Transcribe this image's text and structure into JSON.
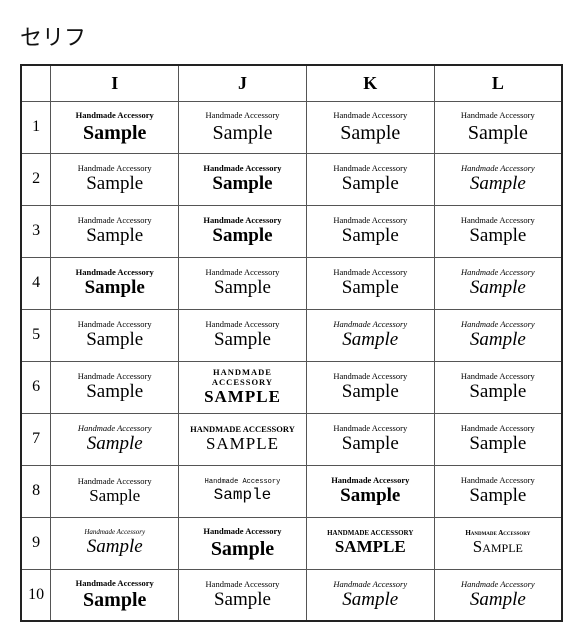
{
  "title": "セリフ",
  "columns": [
    "",
    "I",
    "J",
    "K",
    "L"
  ],
  "topText": "Handmade Accessory",
  "bottomText": "Sample",
  "bottomTextUpper": "SAMPLE",
  "rows": [
    {
      "num": "1",
      "cells": [
        "I",
        "J",
        "K",
        "L"
      ]
    },
    {
      "num": "2",
      "cells": [
        "I",
        "J",
        "K",
        "L"
      ]
    },
    {
      "num": "3",
      "cells": [
        "I",
        "J",
        "K",
        "L"
      ]
    },
    {
      "num": "4",
      "cells": [
        "I",
        "J",
        "K",
        "L"
      ]
    },
    {
      "num": "5",
      "cells": [
        "I",
        "J",
        "K",
        "L"
      ]
    },
    {
      "num": "6",
      "cells": [
        "I",
        "J",
        "K",
        "L"
      ]
    },
    {
      "num": "7",
      "cells": [
        "I",
        "J",
        "K",
        "L"
      ]
    },
    {
      "num": "8",
      "cells": [
        "I",
        "J",
        "K",
        "L"
      ]
    },
    {
      "num": "9",
      "cells": [
        "I",
        "J",
        "K",
        "L"
      ]
    },
    {
      "num": "10",
      "cells": [
        "I",
        "J",
        "K",
        "L"
      ]
    }
  ],
  "cell_data": {
    "r6J_top": "HANDMADE ACCESSORY",
    "r6J_bottom": "SAMPLE",
    "r7J_top": "HANDMADE ACCESSORY",
    "r7J_bottom": "SAMPLE",
    "r9K_top": "HANDMADE ACCESSORY",
    "r9K_bottom": "SAMPLE",
    "r9L_top": "HANDMADE ACCESSORY",
    "r9L_bottom": "SAMPLE"
  }
}
